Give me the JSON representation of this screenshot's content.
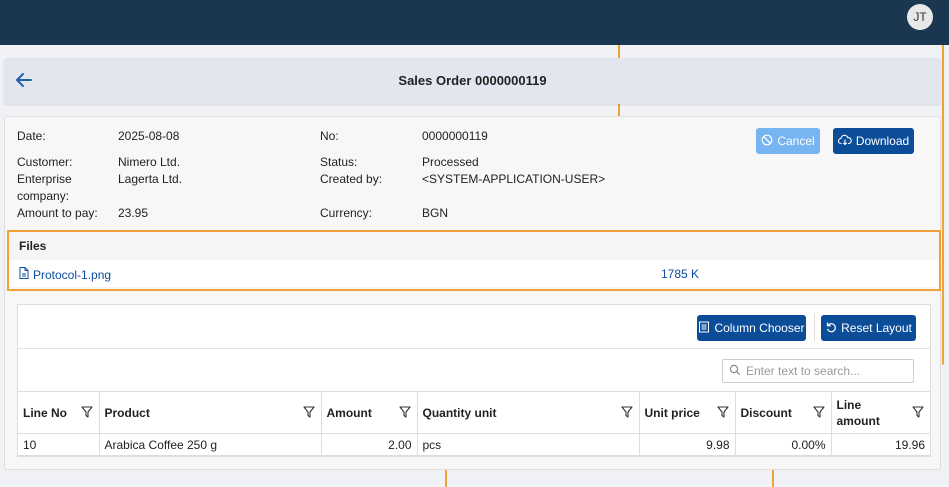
{
  "topbar": {
    "avatar_initials": "JT"
  },
  "header": {
    "title": "Sales Order 0000000119"
  },
  "details": {
    "date_label": "Date:",
    "date_value": "2025-08-08",
    "no_label": "No:",
    "no_value": "0000000119",
    "customer_label": "Customer:",
    "customer_value": "Nimero Ltd.",
    "status_label": "Status:",
    "status_value": "Processed",
    "enterprise_label_1": "Enterprise",
    "enterprise_label_2": "company:",
    "enterprise_value": "Lagerta Ltd.",
    "created_by_label": "Created by:",
    "created_by_value": "<SYSTEM-APPLICATION-USER>",
    "amount_label": "Amount to pay:",
    "amount_value": "23.95",
    "currency_label": "Currency:",
    "currency_value": "BGN"
  },
  "actions": {
    "cancel_label": "Cancel",
    "download_label": "Download"
  },
  "files": {
    "title": "Files",
    "items": [
      {
        "name": "Protocol-1.png",
        "size": "1785 K"
      }
    ]
  },
  "grid": {
    "column_chooser_label": "Column Chooser",
    "reset_layout_label": "Reset Layout",
    "search_placeholder": "Enter text to search...",
    "columns": [
      "Line No",
      "Product",
      "Amount",
      "Quantity unit",
      "Unit price",
      "Discount",
      "Line amount"
    ],
    "rows": [
      {
        "line_no": "10",
        "product": "Arabica Coffee 250 g",
        "amount": "2.00",
        "quantity_unit": "pcs",
        "unit_price": "9.98",
        "discount": "0.00%",
        "line_amount": "19.96"
      }
    ]
  },
  "colors": {
    "topbar": "#1b3650",
    "primary": "#0c4d9a",
    "cancel_disabled": "#76b4f2",
    "highlight": "#f0a23a"
  }
}
